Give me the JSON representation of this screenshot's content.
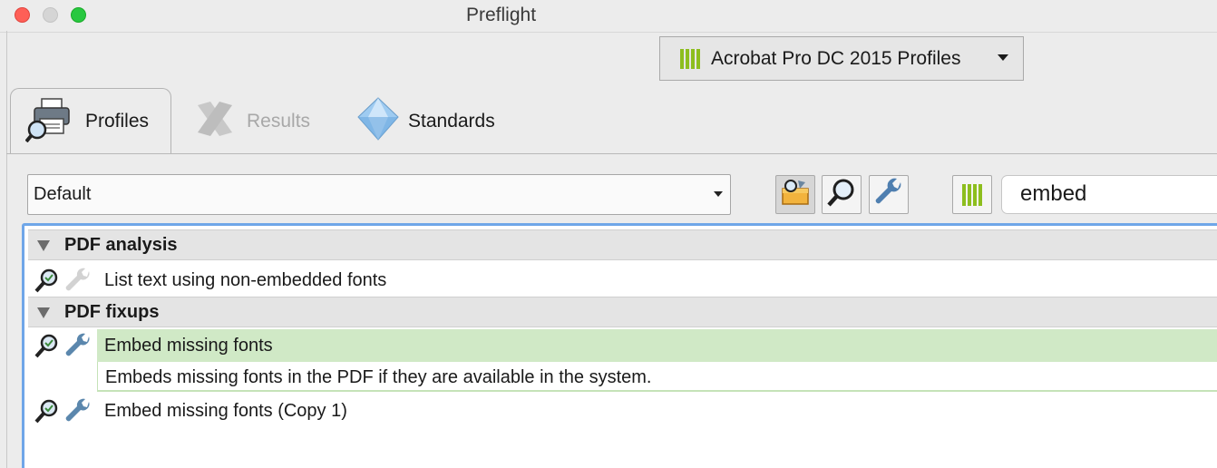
{
  "window": {
    "title": "Preflight"
  },
  "profile_set": {
    "label": "Acrobat Pro DC 2015 Profiles"
  },
  "tabs": [
    {
      "label": "Profiles",
      "active": true,
      "enabled": true
    },
    {
      "label": "Results",
      "active": false,
      "enabled": false
    },
    {
      "label": "Standards",
      "active": false,
      "enabled": true
    }
  ],
  "toolbar": {
    "filter_value": "Default",
    "search_value": "embed"
  },
  "tree": {
    "groups": [
      {
        "label": "PDF analysis",
        "items": [
          {
            "label": "List text using non-embedded fonts",
            "has_fixup": false
          }
        ]
      },
      {
        "label": "PDF fixups",
        "items": [
          {
            "label": "Embed missing fonts",
            "selected": true,
            "description": "Embeds missing fonts in the PDF if they are available in the system.",
            "has_fixup": true
          },
          {
            "label": "Embed missing fonts (Copy 1)",
            "has_fixup": true
          }
        ]
      }
    ]
  },
  "colors": {
    "accent": "#6fa6e8",
    "selected_row": "#d0e9c6",
    "profile_bars": "#8dbe1e"
  }
}
